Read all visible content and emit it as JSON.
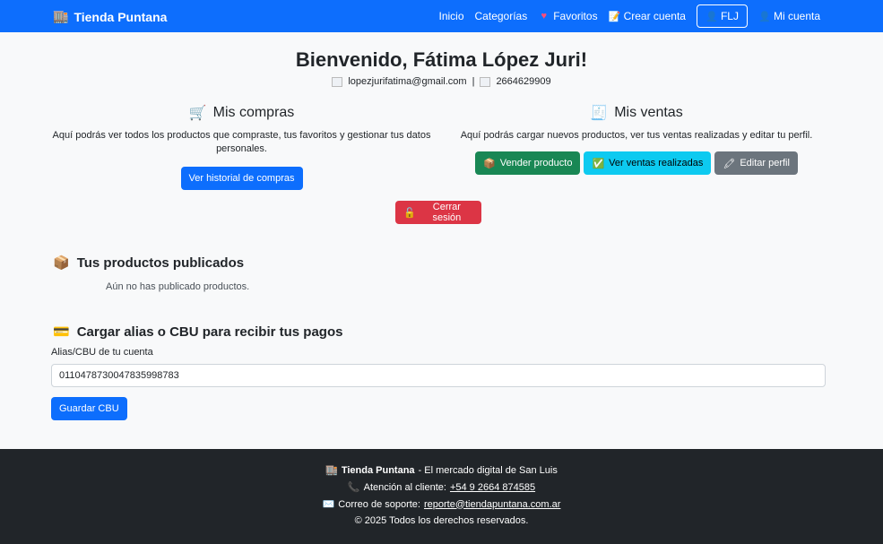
{
  "navbar": {
    "brand": "Tienda Puntana",
    "brand_icon": "store-icon",
    "links": {
      "inicio": "Inicio",
      "categorias": "Categorías",
      "favoritos": "Favoritos",
      "crear_cuenta": "Crear cuenta",
      "initials": "FLJ",
      "mi_cuenta": "Mi cuenta"
    }
  },
  "profile": {
    "welcome": "Bienvenido, Fátima López Juri!",
    "email": "lopezjurifatima@gmail.com",
    "separator": "|",
    "phone": "2664629909"
  },
  "compras": {
    "title": "Mis compras",
    "description": "Aquí podrás ver todos los productos que compraste, tus favoritos y gestionar tus datos personales.",
    "button": "Ver historial de compras"
  },
  "ventas": {
    "title": "Mis ventas",
    "description": "Aquí podrás cargar nuevos productos, ver tus ventas realizadas y editar tu perfil.",
    "btn_vender": "Vender producto",
    "btn_ventas": "Ver ventas realizadas",
    "btn_editar": "Editar perfil"
  },
  "logout": {
    "label": "Cerrar sesión"
  },
  "productos": {
    "title": "Tus productos publicados",
    "empty": "Aún no has publicado productos."
  },
  "cbu": {
    "title": "Cargar alias o CBU para recibir tus pagos",
    "label": "Alias/CBU de tu cuenta",
    "value": "0110478730047835998783",
    "button": "Guardar CBU"
  },
  "footer": {
    "brand": "Tienda Puntana",
    "tagline": "- El mercado digital de San Luis",
    "support_label": "Atención al cliente:",
    "support_phone": "+54 9 2664 874585",
    "email_label": "Correo de soporte:",
    "email": "reporte@tiendapuntana.com.ar",
    "copyright": "© 2025 Todos los derechos reservados."
  },
  "colors": {
    "primary": "#0d6efd",
    "success": "#198754",
    "info": "#0dcaf0",
    "secondary": "#6c757d",
    "danger": "#dc3545",
    "footer_bg": "#212529"
  }
}
